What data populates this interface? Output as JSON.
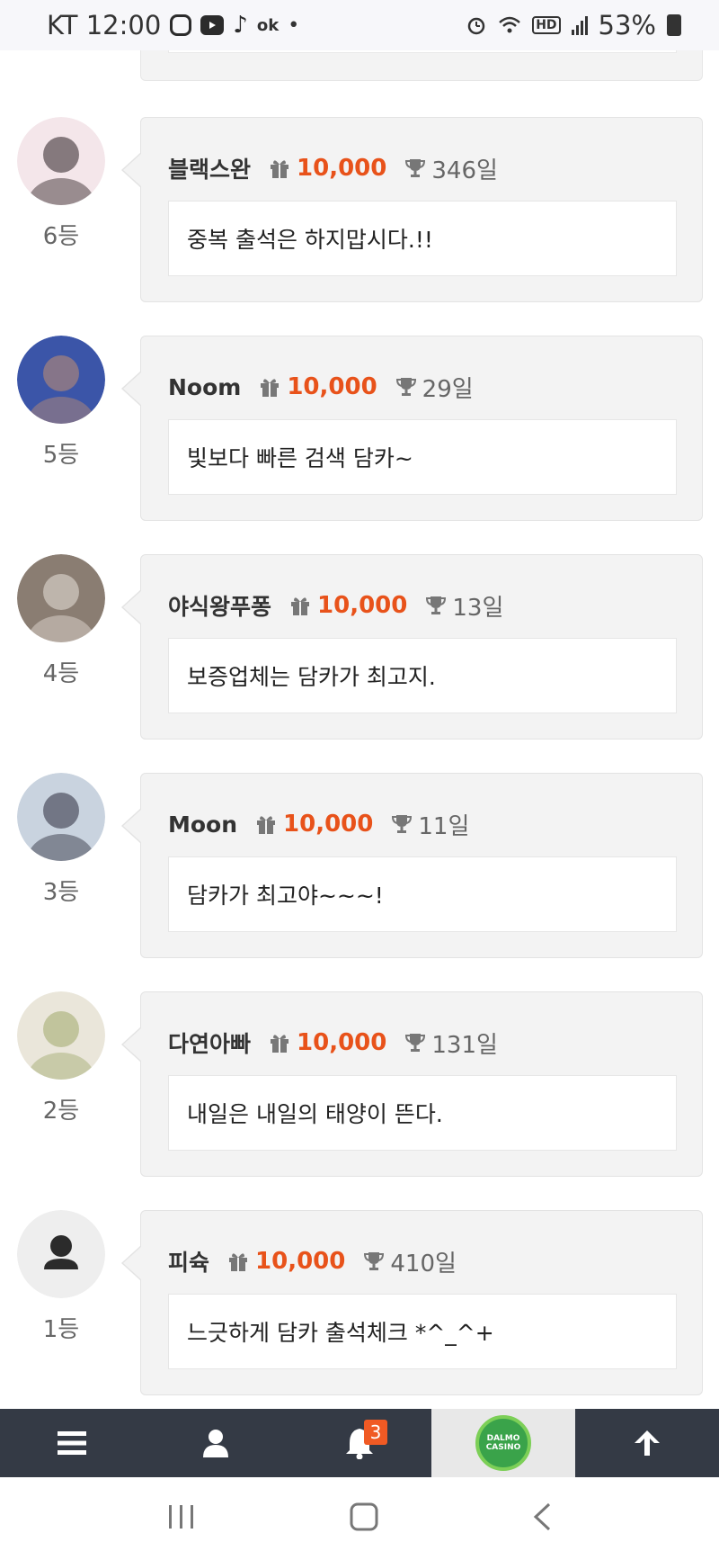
{
  "status_bar": {
    "carrier_time": "KT 12:00",
    "ok_label": "ok",
    "dot": "•",
    "hd_label": "HD",
    "battery": "53%"
  },
  "entries": [
    {
      "nickname": "블랙스완",
      "points": "10,000",
      "days": "346일",
      "message": "중복 출석은 하지맙시다.!!",
      "rank": "6등",
      "avatar": "photo-avatar"
    },
    {
      "nickname": "Noom",
      "points": "10,000",
      "days": "29일",
      "message": "빛보다 빠른 검색 담카~",
      "rank": "5등",
      "avatar": "photo-avatar"
    },
    {
      "nickname": "야식왕푸퐁",
      "points": "10,000",
      "days": "13일",
      "message": "보증업체는 담카가 최고지.",
      "rank": "4등",
      "avatar": "photo-avatar"
    },
    {
      "nickname": "Moon",
      "points": "10,000",
      "days": "11일",
      "message": "담카가 최고야~~~!",
      "rank": "3등",
      "avatar": "photo-avatar"
    },
    {
      "nickname": "다연아빠",
      "points": "10,000",
      "days": "131일",
      "message": "내일은 내일의 태양이 뜬다.",
      "rank": "2등",
      "avatar": "photo-avatar"
    },
    {
      "nickname": "피슉",
      "points": "10,000",
      "days": "410일",
      "message": "느긋하게 담카 출석체크 *^_^+",
      "rank": "1등",
      "avatar": "default-user-avatar"
    }
  ],
  "bottom_nav": {
    "notification_count": "3",
    "logo_text_1": "DALMO",
    "logo_text_2": "CASINO"
  },
  "colors": {
    "accent": "#e8521a",
    "nav_bg": "#343a45",
    "card_bg": "#f3f3f3"
  }
}
